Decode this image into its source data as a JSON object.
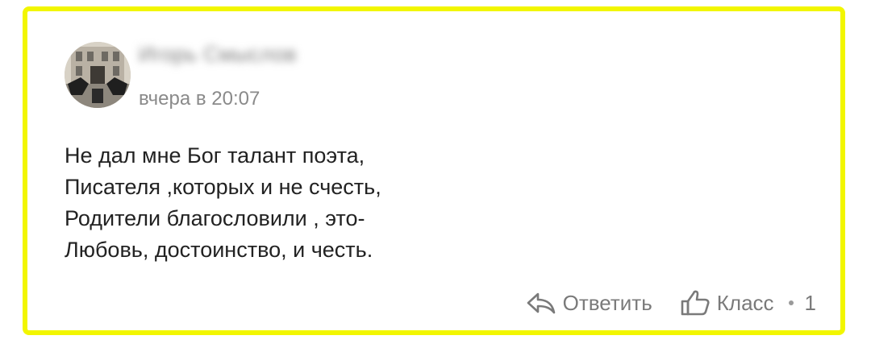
{
  "comment": {
    "author": "Игорь Смыслов",
    "timestamp": "вчера в 20:07",
    "poem_lines": [
      "Не дал мне Бог талант поэта,",
      "Писателя ,которых и не счесть,",
      "Родители благословили , это-",
      "Любовь, достоинство, и честь."
    ]
  },
  "actions": {
    "reply_label": "Ответить",
    "like_label": "Класс",
    "like_count": "1"
  },
  "colors": {
    "highlight_border": "#f2f600",
    "muted_text": "#7a7a7a",
    "body_text": "#222222"
  },
  "icons": {
    "reply": "reply-arrow-icon",
    "like": "thumbs-up-icon"
  }
}
